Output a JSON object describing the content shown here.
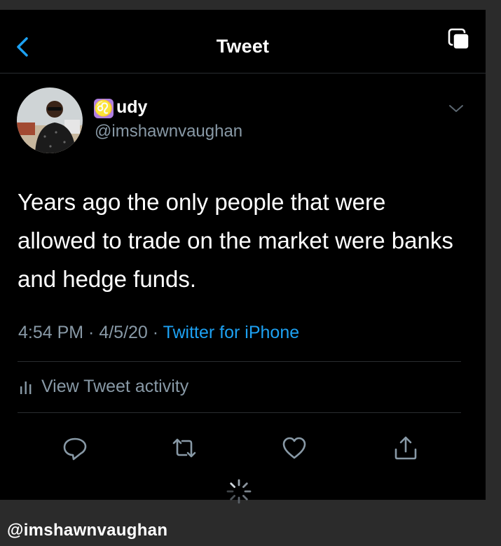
{
  "nav": {
    "title": "Tweet",
    "back_icon": "chevron-left-icon",
    "copy_icon": "copy-icon",
    "accent": "#1da1f2"
  },
  "tweet": {
    "emoji": "♌",
    "display_name": "udy",
    "handle": "@imshawnvaughan",
    "text": "Years ago the only people that were allowed to trade on the market were banks and hedge funds.",
    "time": "4:54 PM",
    "separator1": " · ",
    "date": "4/5/20",
    "separator2": " · ",
    "source": "Twitter for iPhone"
  },
  "activity": {
    "label": "View Tweet activity",
    "icon": "bar-chart-icon"
  },
  "actions": [
    "reply-icon",
    "retweet-icon",
    "like-icon",
    "share-icon"
  ],
  "caption": "@imshawnvaughan"
}
